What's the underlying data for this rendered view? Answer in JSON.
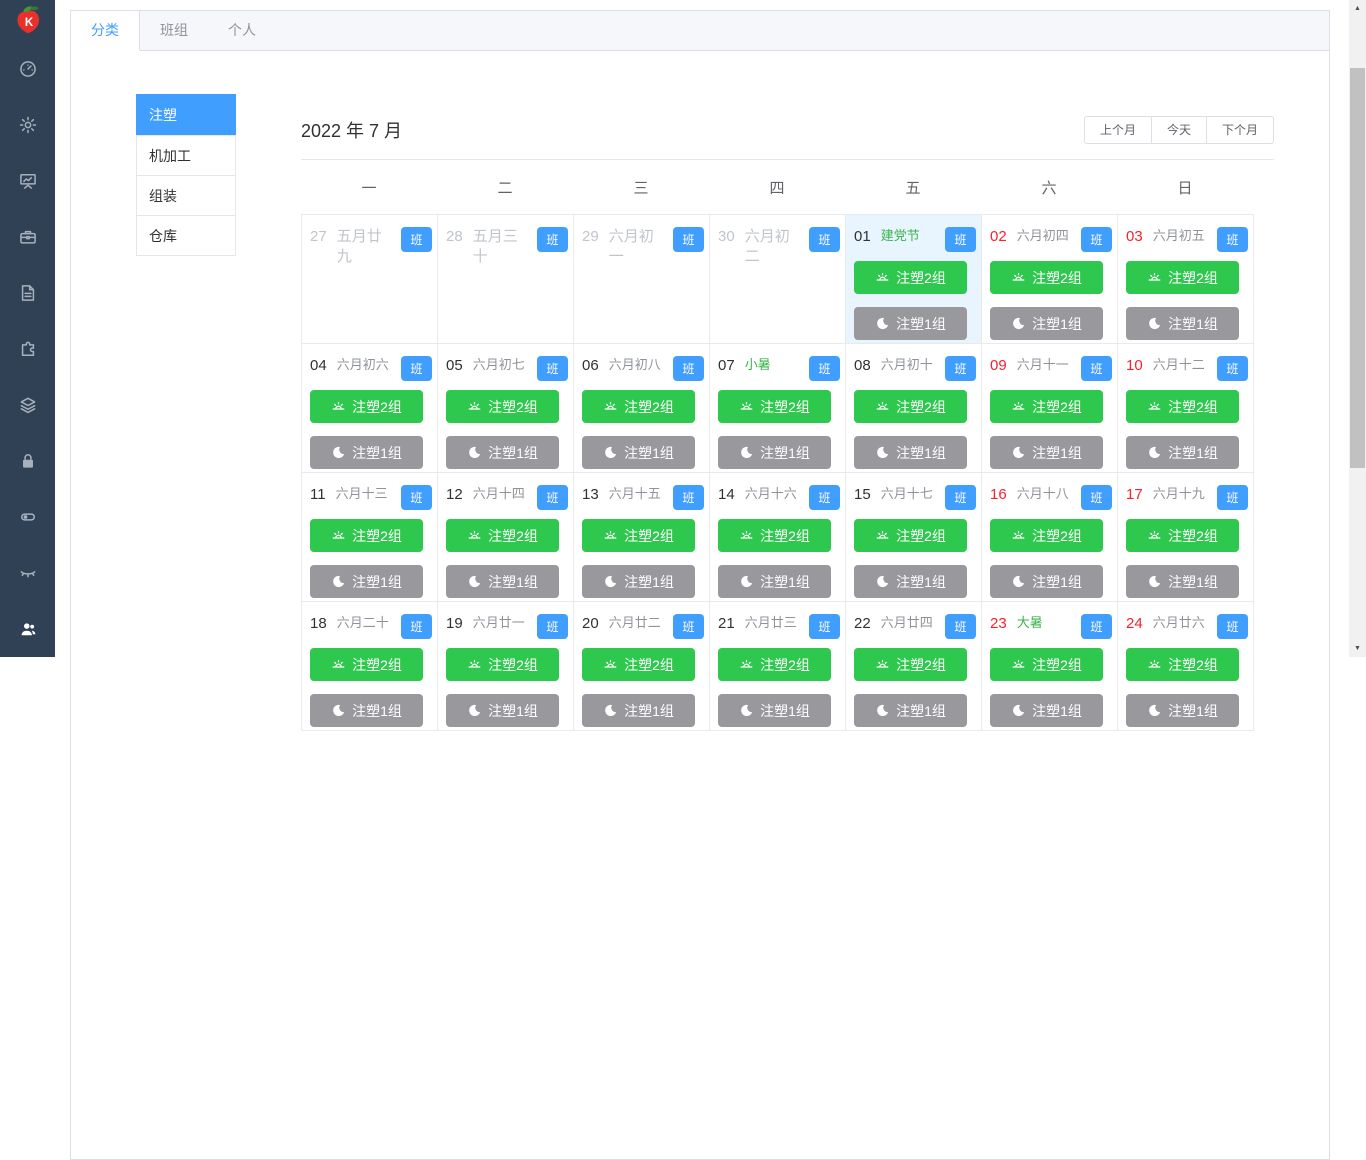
{
  "sidebar": {
    "logo": "strawberry-logo",
    "icons": [
      {
        "id": "dashboard-icon"
      },
      {
        "id": "settings-gear-icon"
      },
      {
        "id": "presentation-chart-icon"
      },
      {
        "id": "toolbox-icon"
      },
      {
        "id": "document-icon"
      },
      {
        "id": "puzzle-icon"
      },
      {
        "id": "layers-icon"
      },
      {
        "id": "lock-icon"
      },
      {
        "id": "toggle-icon"
      },
      {
        "id": "eye-closed-icon"
      },
      {
        "id": "users-icon",
        "active": true
      }
    ]
  },
  "tabs": [
    {
      "id": "tab-category",
      "label": "分类",
      "active": true
    },
    {
      "id": "tab-team",
      "label": "班组",
      "active": false
    },
    {
      "id": "tab-personal",
      "label": "个人",
      "active": false
    }
  ],
  "categories": [
    {
      "id": "category-injection",
      "label": "注塑",
      "active": true
    },
    {
      "id": "category-machining",
      "label": "机加工",
      "active": false
    },
    {
      "id": "category-assembly",
      "label": "组装",
      "active": false
    },
    {
      "id": "category-warehouse",
      "label": "仓库",
      "active": false
    }
  ],
  "calendar": {
    "title": "2022 年 7 月",
    "nav_buttons": [
      {
        "id": "prev-month-button",
        "label": "上个月"
      },
      {
        "id": "today-button",
        "label": "今天"
      },
      {
        "id": "next-month-button",
        "label": "下个月"
      }
    ],
    "weekdays": [
      "一",
      "二",
      "三",
      "四",
      "五",
      "六",
      "日"
    ],
    "badge_label": "班",
    "day_shift_label": "注塑2组",
    "night_shift_label": "注塑1组",
    "day_shift_icon": "sunrise-icon",
    "night_shift_icon": "moon-icon",
    "days": [
      {
        "num": "27",
        "lunar": "五月廿九",
        "other_month": true,
        "weekend": false,
        "holiday": false,
        "highlight": false,
        "shifts": false
      },
      {
        "num": "28",
        "lunar": "五月三十",
        "other_month": true,
        "weekend": false,
        "holiday": false,
        "highlight": false,
        "shifts": false
      },
      {
        "num": "29",
        "lunar": "六月初一",
        "other_month": true,
        "weekend": false,
        "holiday": false,
        "highlight": false,
        "shifts": false
      },
      {
        "num": "30",
        "lunar": "六月初二",
        "other_month": true,
        "weekend": false,
        "holiday": false,
        "highlight": false,
        "shifts": false
      },
      {
        "num": "01",
        "lunar": "建党节",
        "other_month": false,
        "weekend": false,
        "holiday": true,
        "highlight": true,
        "shifts": true
      },
      {
        "num": "02",
        "lunar": "六月初四",
        "other_month": false,
        "weekend": true,
        "holiday": false,
        "highlight": false,
        "shifts": true
      },
      {
        "num": "03",
        "lunar": "六月初五",
        "other_month": false,
        "weekend": true,
        "holiday": false,
        "highlight": false,
        "shifts": true
      },
      {
        "num": "04",
        "lunar": "六月初六",
        "other_month": false,
        "weekend": false,
        "holiday": false,
        "highlight": false,
        "shifts": true
      },
      {
        "num": "05",
        "lunar": "六月初七",
        "other_month": false,
        "weekend": false,
        "holiday": false,
        "highlight": false,
        "shifts": true
      },
      {
        "num": "06",
        "lunar": "六月初八",
        "other_month": false,
        "weekend": false,
        "holiday": false,
        "highlight": false,
        "shifts": true
      },
      {
        "num": "07",
        "lunar": "小暑",
        "other_month": false,
        "weekend": false,
        "holiday": true,
        "highlight": false,
        "shifts": true
      },
      {
        "num": "08",
        "lunar": "六月初十",
        "other_month": false,
        "weekend": false,
        "holiday": false,
        "highlight": false,
        "shifts": true
      },
      {
        "num": "09",
        "lunar": "六月十一",
        "other_month": false,
        "weekend": true,
        "holiday": false,
        "highlight": false,
        "shifts": true
      },
      {
        "num": "10",
        "lunar": "六月十二",
        "other_month": false,
        "weekend": true,
        "holiday": false,
        "highlight": false,
        "shifts": true
      },
      {
        "num": "11",
        "lunar": "六月十三",
        "other_month": false,
        "weekend": false,
        "holiday": false,
        "highlight": false,
        "shifts": true
      },
      {
        "num": "12",
        "lunar": "六月十四",
        "other_month": false,
        "weekend": false,
        "holiday": false,
        "highlight": false,
        "shifts": true
      },
      {
        "num": "13",
        "lunar": "六月十五",
        "other_month": false,
        "weekend": false,
        "holiday": false,
        "highlight": false,
        "shifts": true
      },
      {
        "num": "14",
        "lunar": "六月十六",
        "other_month": false,
        "weekend": false,
        "holiday": false,
        "highlight": false,
        "shifts": true
      },
      {
        "num": "15",
        "lunar": "六月十七",
        "other_month": false,
        "weekend": false,
        "holiday": false,
        "highlight": false,
        "shifts": true
      },
      {
        "num": "16",
        "lunar": "六月十八",
        "other_month": false,
        "weekend": true,
        "holiday": false,
        "highlight": false,
        "shifts": true
      },
      {
        "num": "17",
        "lunar": "六月十九",
        "other_month": false,
        "weekend": true,
        "holiday": false,
        "highlight": false,
        "shifts": true
      },
      {
        "num": "18",
        "lunar": "六月二十",
        "other_month": false,
        "weekend": false,
        "holiday": false,
        "highlight": false,
        "shifts": true
      },
      {
        "num": "19",
        "lunar": "六月廿一",
        "other_month": false,
        "weekend": false,
        "holiday": false,
        "highlight": false,
        "shifts": true
      },
      {
        "num": "20",
        "lunar": "六月廿二",
        "other_month": false,
        "weekend": false,
        "holiday": false,
        "highlight": false,
        "shifts": true
      },
      {
        "num": "21",
        "lunar": "六月廿三",
        "other_month": false,
        "weekend": false,
        "holiday": false,
        "highlight": false,
        "shifts": true
      },
      {
        "num": "22",
        "lunar": "六月廿四",
        "other_month": false,
        "weekend": false,
        "holiday": false,
        "highlight": false,
        "shifts": true
      },
      {
        "num": "23",
        "lunar": "大暑",
        "other_month": false,
        "weekend": true,
        "holiday": true,
        "highlight": false,
        "shifts": true
      },
      {
        "num": "24",
        "lunar": "六月廿六",
        "other_month": false,
        "weekend": true,
        "holiday": false,
        "highlight": false,
        "shifts": true
      }
    ]
  },
  "colors": {
    "accent_blue": "#409eff",
    "shift_green": "#2ec84e",
    "shift_gray": "#98989d",
    "weekend_red": "#f5222d",
    "holiday_green": "#3bb34b",
    "today_cell_bg": "#e8f4fe",
    "sidebar_bg": "#304156"
  }
}
